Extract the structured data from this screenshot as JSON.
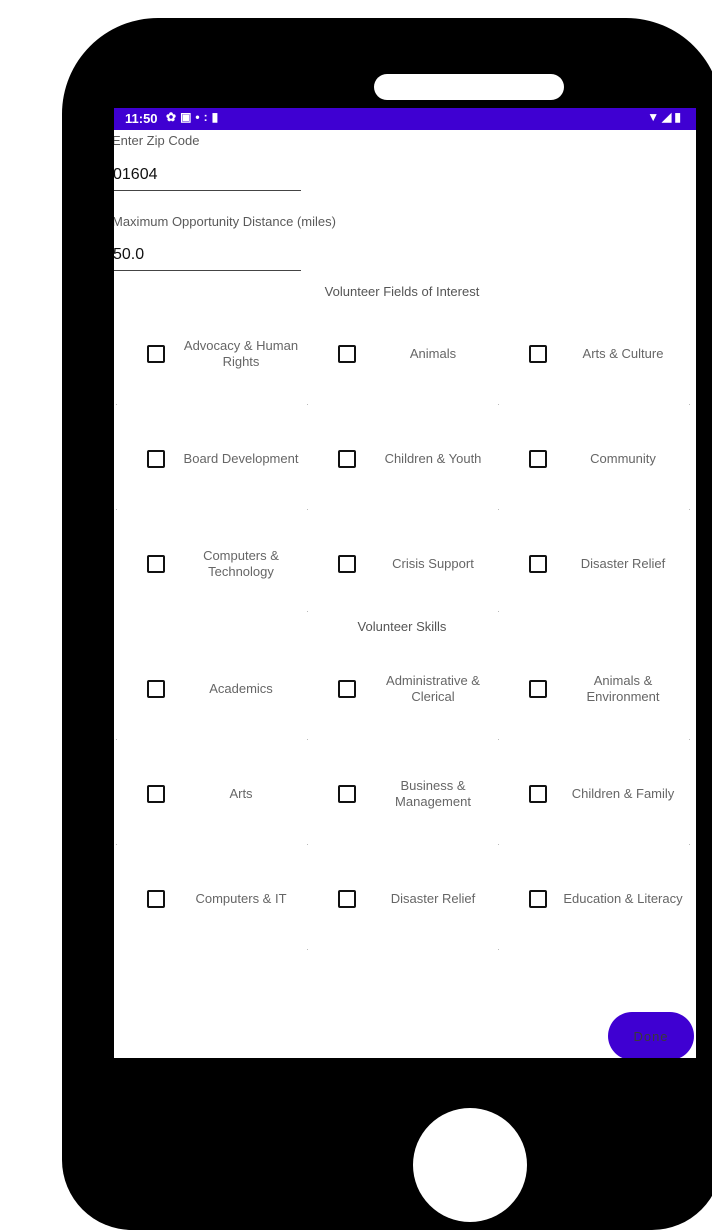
{
  "status_bar": {
    "time": "11:50",
    "left_icons": [
      "gear-icon",
      "image-icon",
      "dots-icon",
      "sd-card-icon"
    ],
    "right_icons": [
      "wifi-icon",
      "signal-icon",
      "battery-icon"
    ]
  },
  "zip": {
    "label": "Enter Zip Code",
    "value": "01604"
  },
  "distance": {
    "label": "Maximum Opportunity Distance (miles)",
    "value": "50.0"
  },
  "fields_section": {
    "title": "Volunteer Fields of Interest",
    "options": [
      "Advocacy & Human Rights",
      "Animals",
      "Arts & Culture",
      "Board Development",
      "Children & Youth",
      "Community",
      "Computers & Technology",
      "Crisis Support",
      "Disaster Relief"
    ]
  },
  "skills_section": {
    "title": "Volunteer Skills",
    "options": [
      "Academics",
      "Administrative & Clerical",
      "Animals & Environment",
      "Arts",
      "Business & Management",
      "Children & Family",
      "Computers & IT",
      "Disaster Relief",
      "Education & Literacy"
    ]
  },
  "done_button": {
    "label": "Done",
    "color": "#3f00d2"
  },
  "colors": {
    "status_bar": "#3f00d2",
    "phone_body": "#000000"
  }
}
